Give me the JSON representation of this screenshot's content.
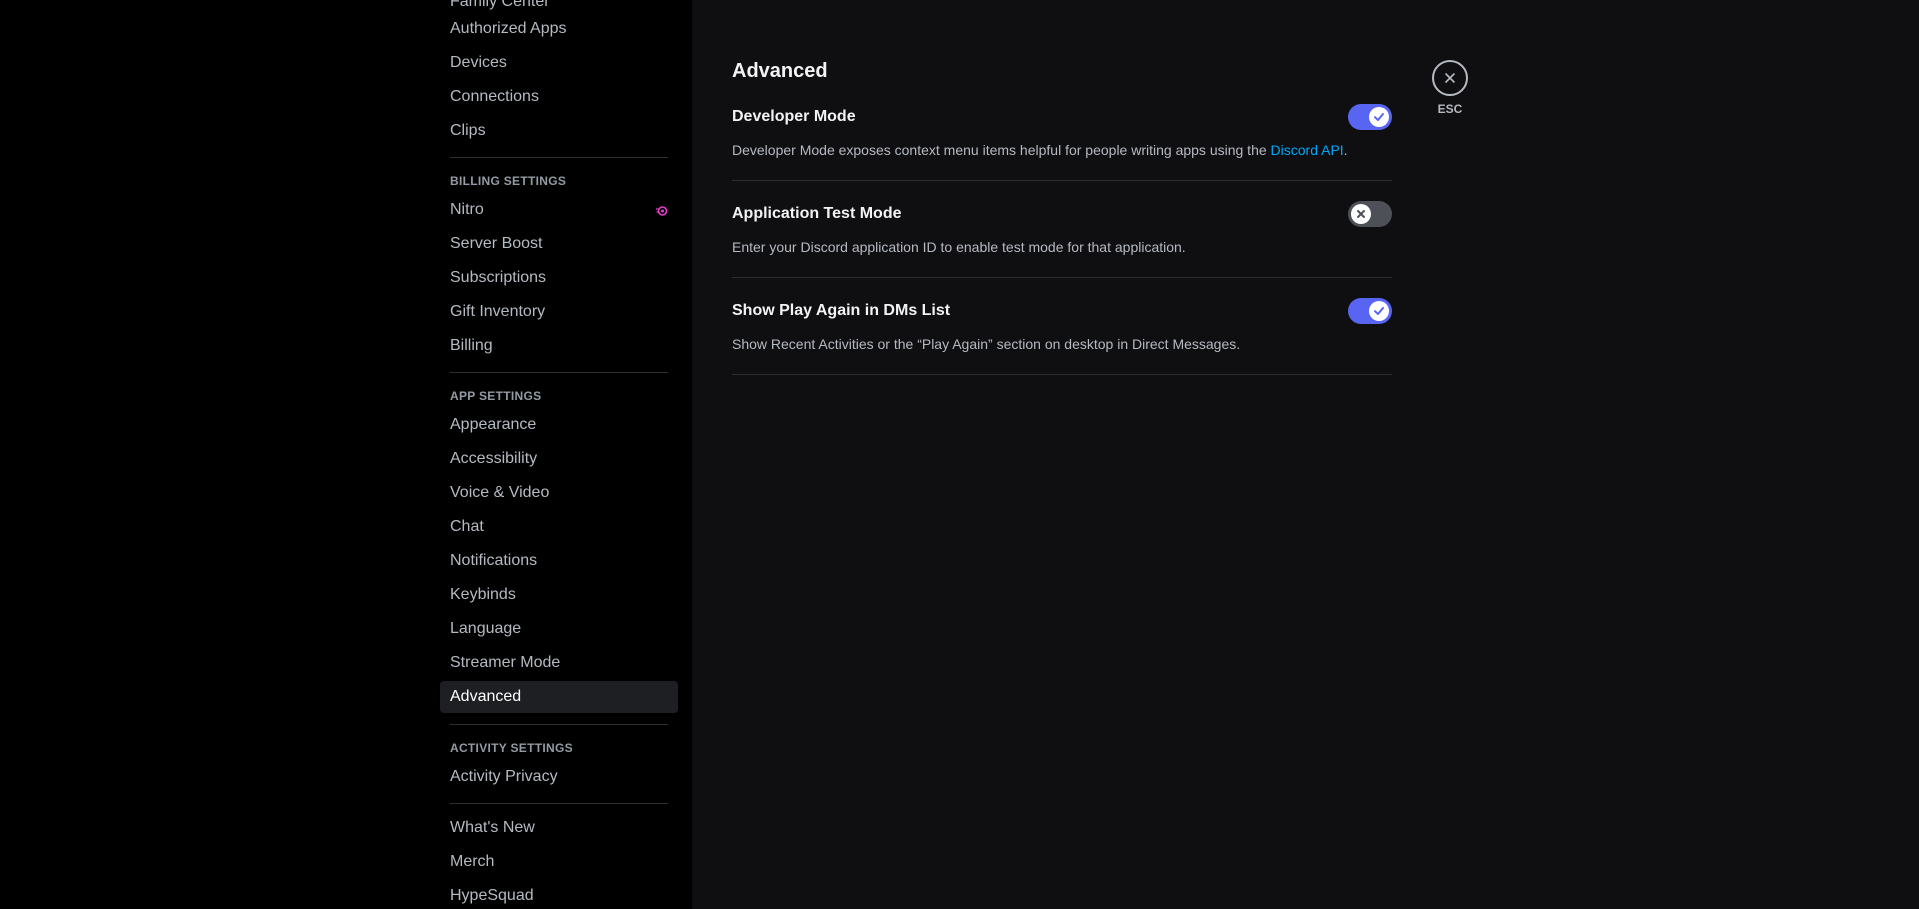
{
  "sidebar": {
    "cut_item": "Family Center",
    "user_items": [
      "Authorized Apps",
      "Devices",
      "Connections",
      "Clips"
    ],
    "billing_header": "BILLING SETTINGS",
    "billing_items": [
      "Nitro",
      "Server Boost",
      "Subscriptions",
      "Gift Inventory",
      "Billing"
    ],
    "app_header": "APP SETTINGS",
    "app_items": [
      "Appearance",
      "Accessibility",
      "Voice & Video",
      "Chat",
      "Notifications",
      "Keybinds",
      "Language",
      "Streamer Mode",
      "Advanced"
    ],
    "activity_header": "ACTIVITY SETTINGS",
    "activity_items": [
      "Activity Privacy"
    ],
    "misc_items": [
      "What's New",
      "Merch",
      "HypeSquad"
    ],
    "selected": "Advanced",
    "nitro_icon": "nitro-icon",
    "nitro_color": "#e83ccf"
  },
  "main": {
    "title": "Advanced",
    "settings": [
      {
        "title": "Developer Mode",
        "description": "Developer Mode exposes context menu items helpful for people writing apps using the ",
        "link": "Discord API",
        "suffix": ".",
        "enabled": true
      },
      {
        "title": "Application Test Mode",
        "description": "Enter your Discord application ID to enable test mode for that application.",
        "enabled": false
      },
      {
        "title": "Show Play Again in DMs List",
        "description": "Show Recent Activities or the “Play Again” section on desktop in Direct Messages.",
        "enabled": true
      }
    ]
  },
  "close": {
    "label": "ESC",
    "icon": "close-icon"
  },
  "colors": {
    "accent": "#5865f2",
    "toggle_off": "#4e5058",
    "link": "#00a8fc"
  }
}
